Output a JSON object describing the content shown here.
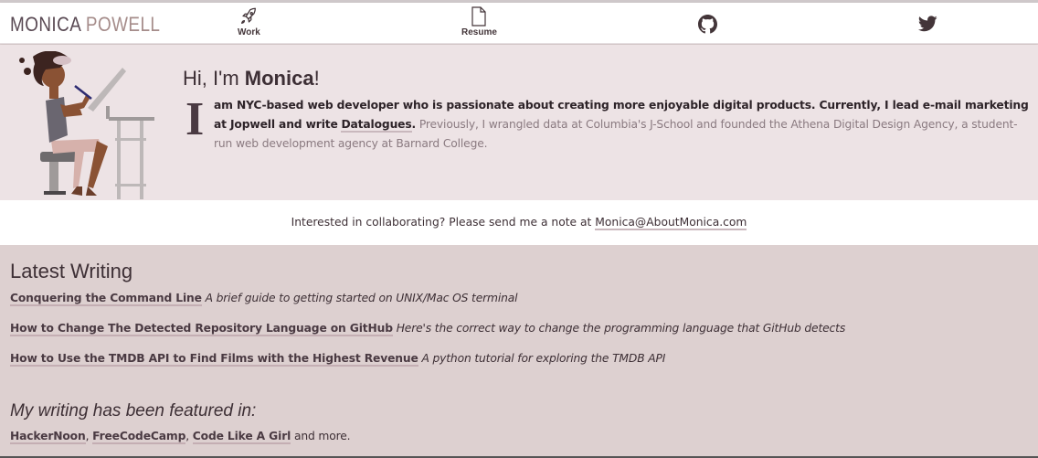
{
  "nav": {
    "logo_first": "MONICA",
    "logo_last": "POWELL",
    "items": [
      {
        "label": "Work",
        "icon": "rocket-icon"
      },
      {
        "label": "Resume",
        "icon": "document-icon"
      },
      {
        "label": "",
        "icon": "github-icon"
      },
      {
        "label": "",
        "icon": "twitter-icon"
      }
    ]
  },
  "hero": {
    "greeting": "Hi, I'm",
    "name": "Monica",
    "exclaim": "!",
    "dropcap": "I",
    "text_dark_1": "am NYC-based web developer who is passionate about creating more enjoyable digital products. Currently, I lead e-mail marketing at Jopwell and write",
    "link_datalogues": "Datalogues",
    "text_dark_2": ".",
    "text_light": "Previously, I wrangled data at Columbia's J-School and founded the Athena Digital Design Agency, a student-run web development agency at Barnard College."
  },
  "contact": {
    "text": "Interested in collaborating? Please send me a note at",
    "email": "Monica@AboutMonica.com"
  },
  "writing": {
    "heading": "Latest Writing",
    "posts": [
      {
        "title": "Conquering the Command Line",
        "desc": "A brief guide to getting started on UNIX/Mac OS terminal"
      },
      {
        "title": "How to Change The Detected Repository Language on GitHub",
        "desc": "Here's the correct way to change the programming language that GitHub detects"
      },
      {
        "title": "How to Use the TMDB API to Find Films with the Highest Revenue",
        "desc": "A python tutorial for exploring the TMDB API"
      }
    ],
    "featured_heading": "My writing has been featured in:",
    "featured": [
      "HackerNoon",
      "FreeCodeCamp",
      "Code Like A Girl"
    ],
    "featured_sep": ",",
    "featured_suffix": "and more."
  },
  "colors": {
    "nav_bg": "#ffffff",
    "hero_bg": "#ede3e5",
    "writing_bg": "#ddd0d0",
    "text": "#3d2f35",
    "logo_last": "#a58c8a"
  }
}
